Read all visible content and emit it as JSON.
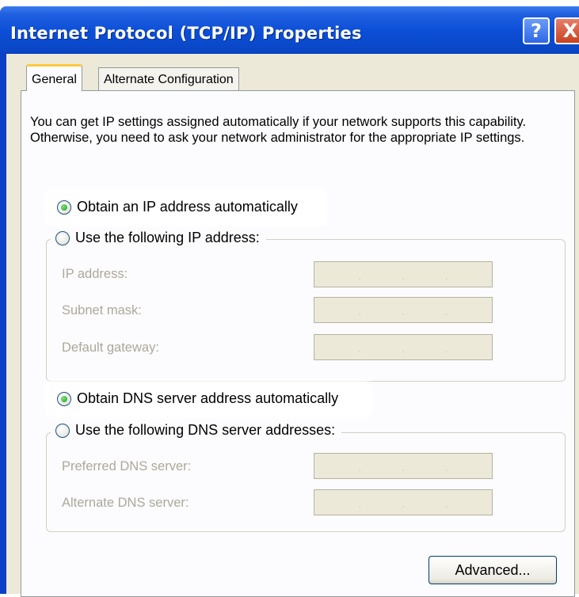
{
  "window": {
    "title": "Internet Protocol (TCP/IP) Properties",
    "help_glyph": "?",
    "close_glyph": "X"
  },
  "tabs": [
    {
      "label": "General",
      "active": true
    },
    {
      "label": "Alternate Configuration",
      "active": false
    }
  ],
  "description": "You can get IP settings assigned automatically if your network supports this capability. Otherwise, you need to ask your network administrator for the appropriate IP settings.",
  "ip": {
    "auto_label": "Obtain an IP address automatically",
    "auto_selected": true,
    "manual_label": "Use the following IP address:",
    "fields": [
      {
        "label": "IP address:",
        "value": ""
      },
      {
        "label": "Subnet mask:",
        "value": ""
      },
      {
        "label": "Default gateway:",
        "value": ""
      }
    ]
  },
  "dns": {
    "auto_label": "Obtain DNS server address automatically",
    "auto_selected": true,
    "manual_label": "Use the following DNS server addresses:",
    "fields": [
      {
        "label": "Preferred DNS server:",
        "value": ""
      },
      {
        "label": "Alternate DNS server:",
        "value": ""
      }
    ]
  },
  "buttons": {
    "advanced_label": "Advanced..."
  },
  "colors": {
    "titlebar": "#0b4ed6",
    "dialog_bg": "#ece9d8",
    "disabled_text": "#aca899",
    "tab_highlight": "#ffc83c"
  }
}
